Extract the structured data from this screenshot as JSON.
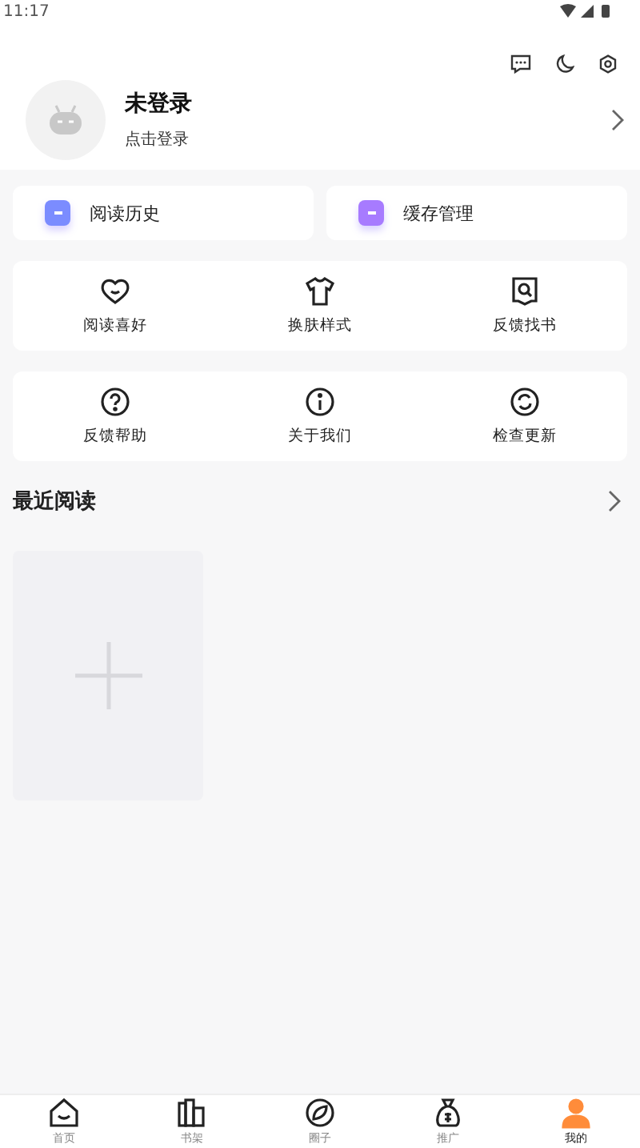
{
  "status_bar": {
    "time": "11:17"
  },
  "profile": {
    "name": "未登录",
    "hint": "点击登录"
  },
  "quick_cards": [
    {
      "label": "阅读历史",
      "color": "#7b8cff"
    },
    {
      "label": "缓存管理",
      "color": "#a77bff"
    }
  ],
  "grid_groups": [
    [
      {
        "label": "阅读喜好"
      },
      {
        "label": "换肤样式"
      },
      {
        "label": "反馈找书"
      }
    ],
    [
      {
        "label": "反馈帮助"
      },
      {
        "label": "关于我们"
      },
      {
        "label": "检查更新"
      }
    ]
  ],
  "recent": {
    "title": "最近阅读"
  },
  "tabs": [
    {
      "label": "首页",
      "selected": false
    },
    {
      "label": "书架",
      "selected": false
    },
    {
      "label": "圈子",
      "selected": false
    },
    {
      "label": "推广",
      "selected": false
    },
    {
      "label": "我的",
      "selected": true
    }
  ]
}
